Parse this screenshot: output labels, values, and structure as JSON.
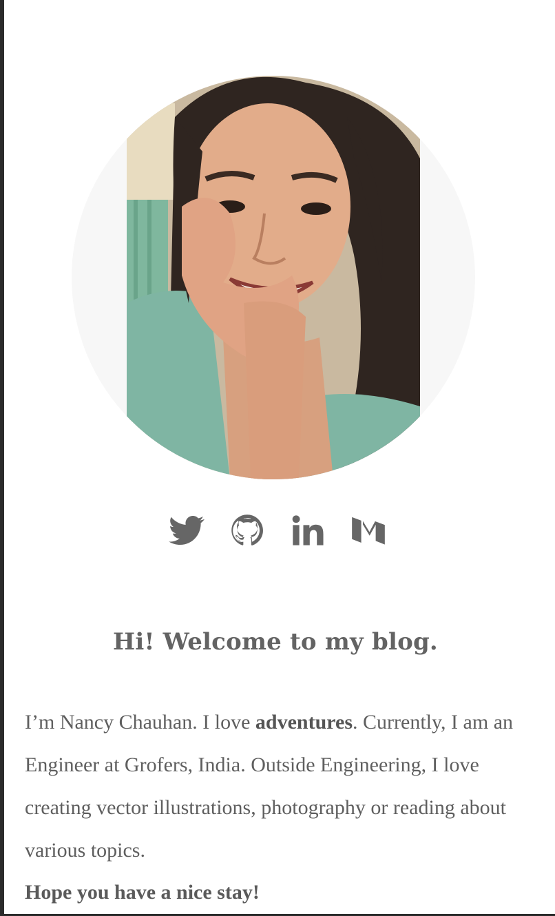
{
  "profile": {
    "photo_alt": "avatar"
  },
  "social": [
    {
      "name": "twitter-icon"
    },
    {
      "name": "github-icon"
    },
    {
      "name": "linkedin-icon"
    },
    {
      "name": "medium-icon"
    }
  ],
  "welcome": {
    "heading": "Hi! Welcome to my blog.",
    "bio_before": "I’m Nancy Chauhan. I love ",
    "bio_strong": "adventures",
    "bio_after": ". Currently, I am an Engineer at Grofers, India. Outside Engineering, I love creating vector illustrations, photography or reading about various topics.",
    "closing": "Hope you have a nice stay!"
  },
  "colors": {
    "text": "#5f5f5f",
    "icon": "#666666",
    "avatar_bg": "#f7f7f7",
    "border": "#2b2b2b"
  }
}
